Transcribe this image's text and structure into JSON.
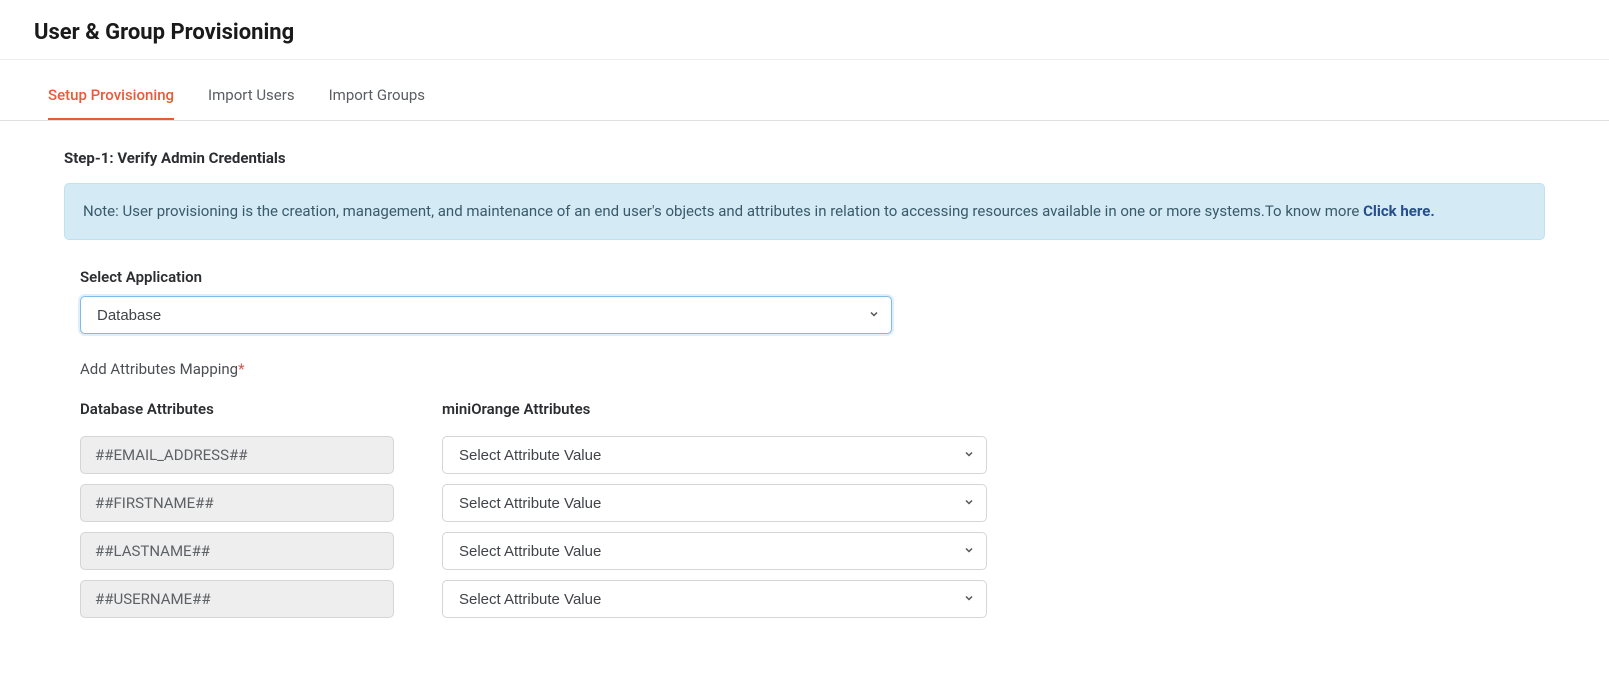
{
  "page_title": "User & Group Provisioning",
  "tabs": {
    "setup": "Setup Provisioning",
    "import_users": "Import Users",
    "import_groups": "Import Groups"
  },
  "step_heading": "Step-1: Verify Admin Credentials",
  "note": {
    "text": "Note: User provisioning is the creation, management, and maintenance of an end user's objects and attributes in relation to accessing resources available in one or more systems.To know more ",
    "link_text": "Click here."
  },
  "select_application": {
    "label": "Select Application",
    "value": "Database"
  },
  "mapping": {
    "heading": "Add Attributes Mapping",
    "required_mark": "*",
    "db_column_header": "Database Attributes",
    "mo_column_header": "miniOrange Attributes",
    "rows": [
      {
        "db": "##EMAIL_ADDRESS##",
        "mo": "Select Attribute Value"
      },
      {
        "db": "##FIRSTNAME##",
        "mo": "Select Attribute Value"
      },
      {
        "db": "##LASTNAME##",
        "mo": "Select Attribute Value"
      },
      {
        "db": "##USERNAME##",
        "mo": "Select Attribute Value"
      }
    ]
  }
}
